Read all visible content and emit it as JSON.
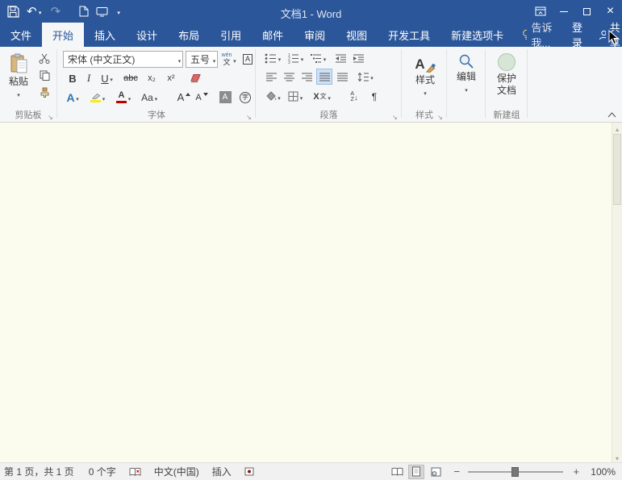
{
  "title_bar": {
    "title": "文档1 - Word"
  },
  "tabs": [
    {
      "label": "文件"
    },
    {
      "label": "开始"
    },
    {
      "label": "插入"
    },
    {
      "label": "设计"
    },
    {
      "label": "布局"
    },
    {
      "label": "引用"
    },
    {
      "label": "邮件"
    },
    {
      "label": "审阅"
    },
    {
      "label": "视图"
    },
    {
      "label": "开发工具"
    },
    {
      "label": "新建选项卡"
    }
  ],
  "tab_extras": {
    "tell_me": "告诉我...",
    "sign_in": "登录",
    "share": "共享"
  },
  "ribbon": {
    "clipboard": {
      "paste": "粘贴",
      "group_label": "剪贴板"
    },
    "font": {
      "group_label": "字体",
      "name_value": "宋体 (中文正文)",
      "size_value": "五号",
      "pinyin_top": "wén",
      "pinyin_bottom": "文",
      "char_border_letter": "A",
      "bold": "B",
      "italic": "I",
      "underline": "U",
      "strikethrough": "abc",
      "subscript": "x₂",
      "superscript": "x²",
      "text_effects_letter": "A",
      "font_color_letter": "A",
      "change_case": "Aa",
      "grow_letter": "A",
      "shrink_letter": "A",
      "char_shading_letter": "A",
      "enclose_char": "字"
    },
    "paragraph": {
      "group_label": "段落",
      "asian_letter": "X",
      "asian_char": "文",
      "sort_top": "A",
      "sort_bottom": "Z",
      "marks": "¶"
    },
    "styles": {
      "group_label": "样式",
      "button": "样式",
      "icon_letter": "A"
    },
    "editing": {
      "button": "编辑"
    },
    "protect": {
      "line1": "保护",
      "line2": "文档",
      "group_label": "新建组"
    }
  },
  "status_bar": {
    "page_info": "第 1 页，共 1 页",
    "word_count": "0 个字",
    "language": "中文(中国)",
    "insert_mode": "插入",
    "zoom_level": "100%"
  },
  "colors": {
    "accent": "#2b579a",
    "document_bg": "#fbfbee",
    "font_color_red": "#c00000",
    "highlight_yellow": "#f1ee19"
  }
}
